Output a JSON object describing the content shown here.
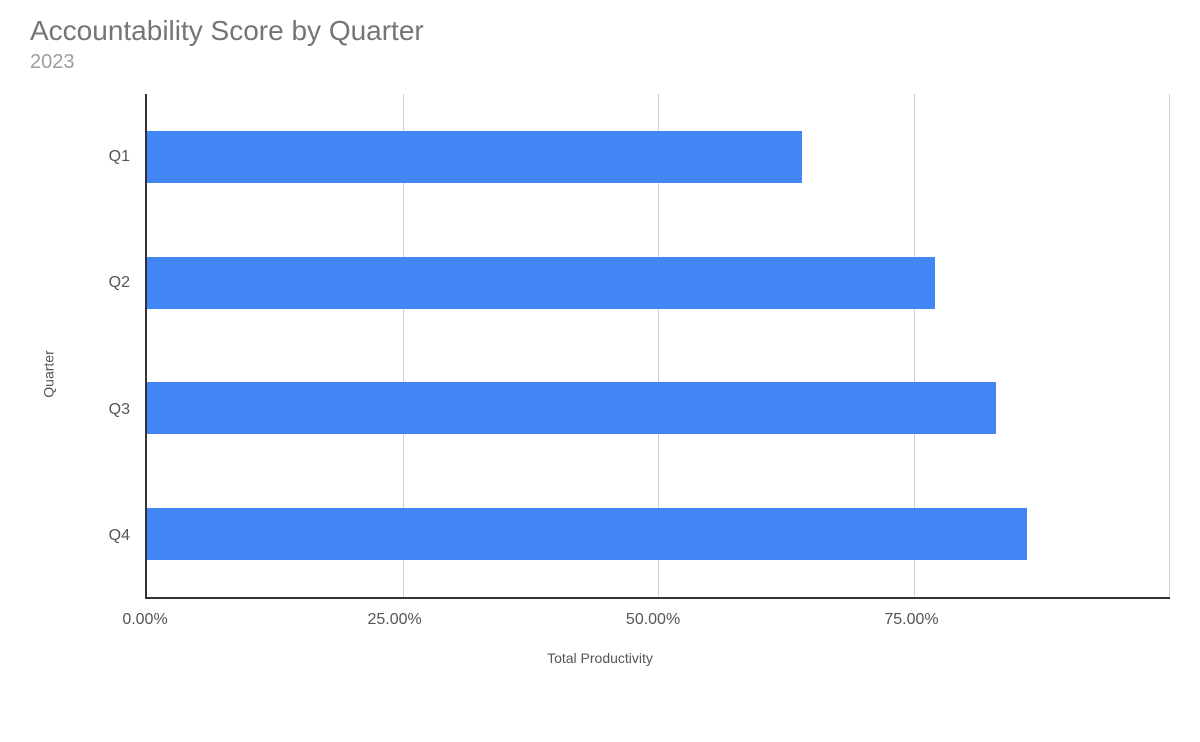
{
  "chart_data": {
    "type": "bar",
    "orientation": "horizontal",
    "title": "Accountability Score by Quarter",
    "subtitle": "2023",
    "xlabel": "Total Productivity",
    "ylabel": "Quarter",
    "categories": [
      "Q1",
      "Q2",
      "Q3",
      "Q4"
    ],
    "values": [
      64,
      77,
      83,
      86
    ],
    "xlim": [
      0,
      100
    ],
    "x_ticks": [
      "0.00%",
      "25.00%",
      "50.00%",
      "75.00%",
      ""
    ],
    "bar_color": "#4285f4"
  }
}
